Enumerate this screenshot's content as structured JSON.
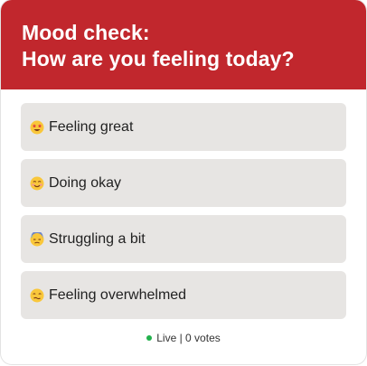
{
  "poll": {
    "title_line1": "Mood check:",
    "title_line2": "How are you feeling today?",
    "header_color": "#c1272d",
    "options": [
      {
        "label": "Feeling great",
        "icon": "star-struck-emoji-icon"
      },
      {
        "label": "Doing okay",
        "icon": "smiling-face-emoji-icon"
      },
      {
        "label": "Struggling a bit",
        "icon": "downcast-sweat-face-emoji-icon"
      },
      {
        "label": "Feeling overwhelmed",
        "icon": "dizzy-face-emoji-icon"
      }
    ]
  },
  "footer": {
    "status": "Live | 0 votes",
    "status_color": "#22b14c"
  }
}
